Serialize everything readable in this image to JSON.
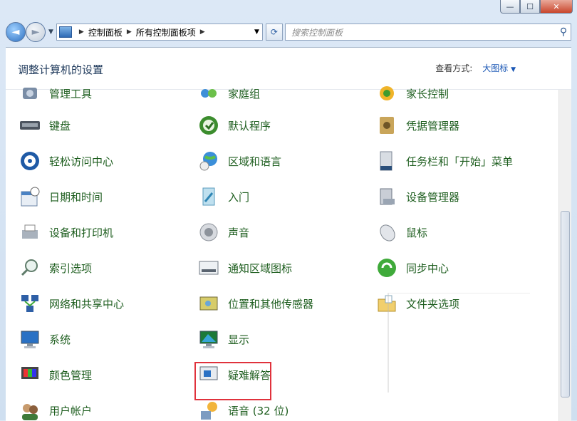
{
  "window": {
    "caption_min": "—",
    "caption_max": "☐",
    "caption_close": "✕"
  },
  "nav": {
    "back": "◄",
    "forward": "►",
    "history": "▼",
    "breadcrumb": [
      "控制面板",
      "所有控制面板项"
    ],
    "sep": "▶",
    "refresh": "⟳",
    "search_placeholder": "搜索控制面板"
  },
  "header": {
    "title": "调整计算机的设置",
    "view_label": "查看方式:",
    "view_value": "大图标",
    "view_arrow": "▼"
  },
  "items": {
    "r0": [
      "管理工具",
      "家庭组",
      "家长控制"
    ],
    "r1": [
      "键盘",
      "默认程序",
      "凭据管理器"
    ],
    "r2": [
      "轻松访问中心",
      "区域和语言",
      "任务栏和「开始」菜单"
    ],
    "r3": [
      "日期和时间",
      "入门",
      "设备管理器"
    ],
    "r4": [
      "设备和打印机",
      "声音",
      "鼠标"
    ],
    "r5": [
      "索引选项",
      "通知区域图标",
      "同步中心"
    ],
    "r6": [
      "网络和共享中心",
      "位置和其他传感器",
      "文件夹选项"
    ],
    "r7": [
      "系统",
      "显示"
    ],
    "r8": [
      "颜色管理",
      "疑难解答"
    ],
    "r9": [
      "用户帐户",
      "语音 (32 位)"
    ]
  },
  "colors": {
    "link": "#1e5e1f",
    "accent": "#1a57b5",
    "highlight": "#e0323c"
  }
}
